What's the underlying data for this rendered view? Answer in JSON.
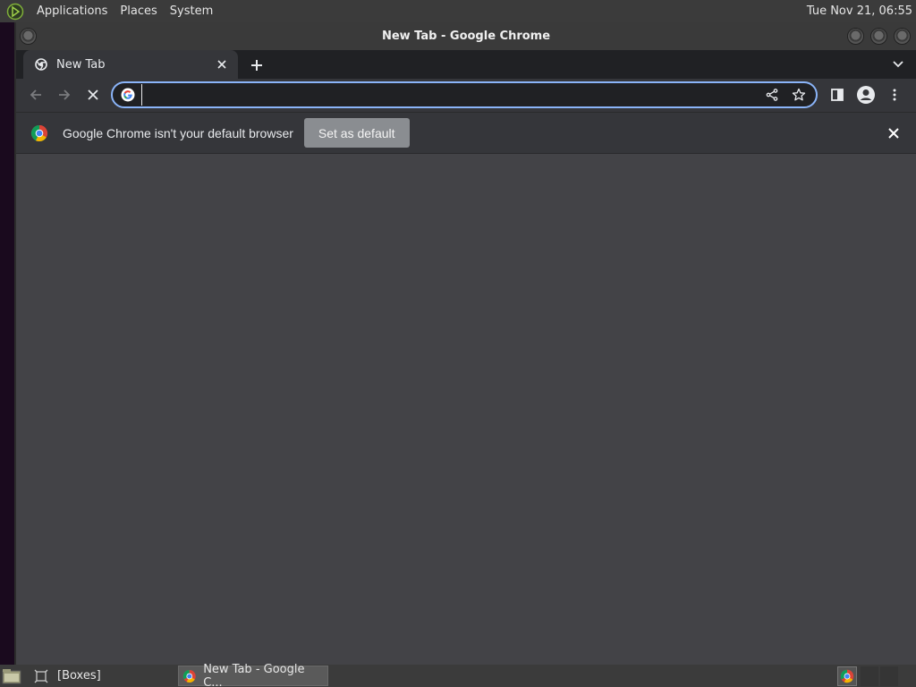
{
  "top_panel": {
    "menus": [
      "Applications",
      "Places",
      "System"
    ],
    "clock": "Tue Nov 21, 06:55"
  },
  "window": {
    "title": "New Tab - Google Chrome"
  },
  "tabs": [
    {
      "label": "New Tab"
    }
  ],
  "omnibox": {
    "value": "",
    "placeholder": ""
  },
  "infobar": {
    "message": "Google Chrome isn't your default browser",
    "button_label": "Set as default"
  },
  "taskbar": {
    "items": [
      {
        "label": "[Boxes]"
      },
      {
        "label": "New Tab - Google C..."
      }
    ]
  },
  "colors": {
    "accent_focus": "#8ab4f8",
    "content_bg": "#434347",
    "toolbar_bg": "#35363a"
  }
}
